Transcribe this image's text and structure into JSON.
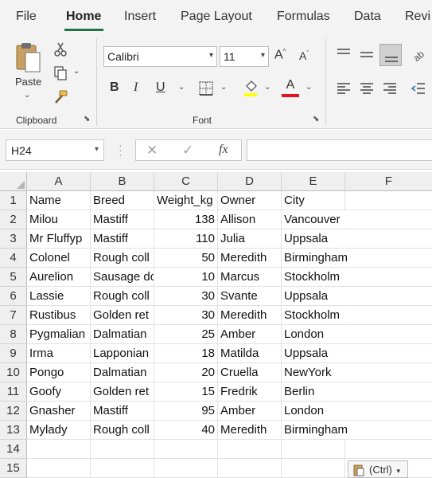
{
  "ribbon_tabs": [
    {
      "label": "File"
    },
    {
      "label": "Home"
    },
    {
      "label": "Insert"
    },
    {
      "label": "Page Layout"
    },
    {
      "label": "Formulas"
    },
    {
      "label": "Data"
    },
    {
      "label": "Revi"
    }
  ],
  "clipboard": {
    "paste_label": "Paste",
    "group_label": "Clipboard"
  },
  "font_group": {
    "font_name": "Calibri",
    "font_size": "11",
    "bold": "B",
    "italic": "I",
    "underline": "U",
    "grow": "A",
    "shrink": "A",
    "font_color_letter": "A",
    "group_label": "Font"
  },
  "formula_bar": {
    "name_box": "H24",
    "cancel": "✕",
    "enter": "✓",
    "fx": "fx",
    "formula": ""
  },
  "columns": [
    "A",
    "B",
    "C",
    "D",
    "E",
    "F"
  ],
  "rows": [
    "1",
    "2",
    "3",
    "4",
    "5",
    "6",
    "7",
    "8",
    "9",
    "10",
    "11",
    "12",
    "13",
    "14",
    "15"
  ],
  "headers": {
    "name": "Name",
    "breed": "Breed",
    "weight": "Weight_kg",
    "owner": "Owner",
    "city": "City"
  },
  "records": [
    {
      "name": "Milou",
      "breed": "Mastiff",
      "weight": "138",
      "owner": "Allison",
      "city": "Vancouver"
    },
    {
      "name": "Mr Fluffyp",
      "breed": "Mastiff",
      "weight": "110",
      "owner": "Julia",
      "city": "Uppsala"
    },
    {
      "name": "Colonel",
      "breed": "Rough coll",
      "weight": "50",
      "owner": "Meredith",
      "city": "Birmingham"
    },
    {
      "name": "Aurelion",
      "breed": "Sausage do",
      "weight": "10",
      "owner": "Marcus",
      "city": "Stockholm"
    },
    {
      "name": "Lassie",
      "breed": "Rough coll",
      "weight": "30",
      "owner": "Svante",
      "city": "Uppsala"
    },
    {
      "name": "Rustibus",
      "breed": "Golden ret",
      "weight": "30",
      "owner": "Meredith",
      "city": "Stockholm"
    },
    {
      "name": "Pygmalian",
      "breed": "Dalmatian",
      "weight": "25",
      "owner": "Amber",
      "city": "London"
    },
    {
      "name": "Irma",
      "breed": "Lapponian",
      "weight": "18",
      "owner": "Matilda",
      "city": "Uppsala"
    },
    {
      "name": "Pongo",
      "breed": "Dalmatian",
      "weight": "20",
      "owner": "Cruella",
      "city": "NewYork"
    },
    {
      "name": "Goofy",
      "breed": "Golden ret",
      "weight": "15",
      "owner": "Fredrik",
      "city": "Berlin"
    },
    {
      "name": "Gnasher",
      "breed": "Mastiff",
      "weight": "95",
      "owner": "Amber",
      "city": "London"
    },
    {
      "name": "Mylady",
      "breed": "Rough coll",
      "weight": "40",
      "owner": "Meredith",
      "city": "Birmingham"
    }
  ],
  "paste_options": {
    "label": "(Ctrl)"
  },
  "colors": {
    "accent": "#217346",
    "ribbon_bg": "#f3f3f3",
    "header_bg": "#efefef",
    "font_color_bar": "#e81123",
    "highlight_bar": "#ffff00"
  }
}
